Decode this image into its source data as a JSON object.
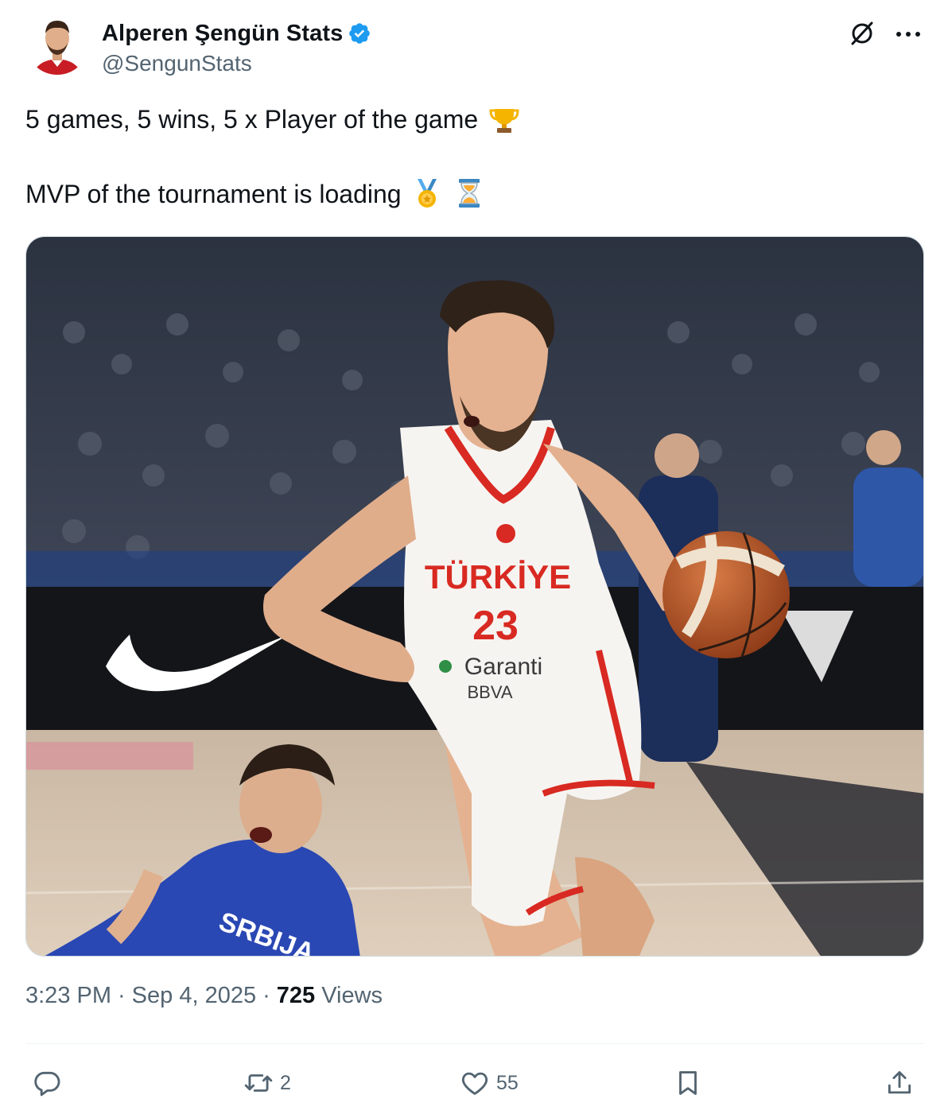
{
  "author": {
    "display_name": "Alperen Şengün Stats",
    "handle": "@SengunStats",
    "verified": true,
    "avatar_icon": "avatar-icon",
    "verified_color": "#1d9bf0"
  },
  "tweet": {
    "line1": "5 games, 5 wins, 5 x Player of the game",
    "line1_emoji": "trophy-emoji",
    "line2": "MVP of the tournament is loading",
    "line2_emojis": [
      "medal-emoji",
      "hourglass-emoji"
    ]
  },
  "media": {
    "jersey_country": "TÜRKİYE",
    "jersey_number": "23",
    "jersey_sponsor": "Garanti",
    "jersey_sponsor_sub": "BBVA",
    "opponent_text": "SRBIJA"
  },
  "meta": {
    "time": "3:23 PM",
    "separator": "·",
    "date": "Sep 4, 2025",
    "views_count": "725",
    "views_label": "Views"
  },
  "actions": {
    "reply_count": "",
    "retweet_count": "2",
    "like_count": "55"
  },
  "colors": {
    "text_primary": "#0f1419",
    "text_secondary": "#536471",
    "divider": "#eff3f4",
    "accent": "#1d9bf0"
  }
}
